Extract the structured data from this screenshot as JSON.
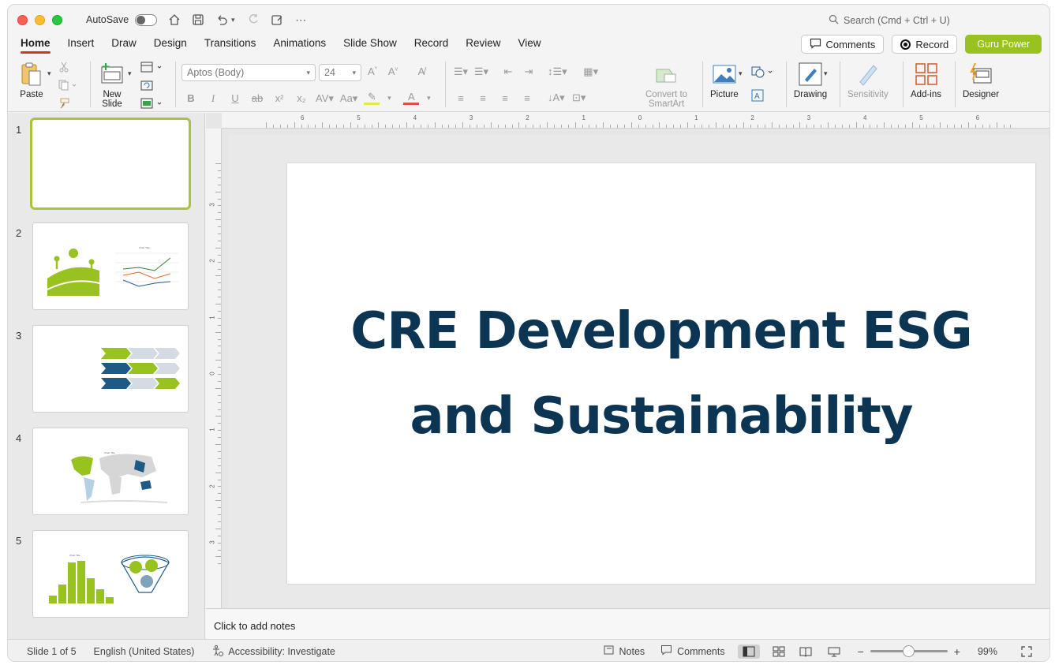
{
  "titlebar": {
    "autosave_label": "AutoSave",
    "search_placeholder": "Search (Cmd + Ctrl + U)"
  },
  "tabs": [
    {
      "label": "Home",
      "active": true
    },
    {
      "label": "Insert"
    },
    {
      "label": "Draw"
    },
    {
      "label": "Design"
    },
    {
      "label": "Transitions"
    },
    {
      "label": "Animations"
    },
    {
      "label": "Slide Show"
    },
    {
      "label": "Record"
    },
    {
      "label": "Review"
    },
    {
      "label": "View"
    }
  ],
  "header_actions": {
    "comments": "Comments",
    "record": "Record",
    "guru": "Guru Power"
  },
  "ribbon": {
    "paste": "Paste",
    "new_slide_1": "New",
    "new_slide_2": "Slide",
    "font_name": "Aptos (Body)",
    "font_size": "24",
    "convert_1": "Convert to",
    "convert_2": "SmartArt",
    "picture": "Picture",
    "drawing": "Drawing",
    "sensitivity": "Sensitivity",
    "addins": "Add-ins",
    "designer": "Designer"
  },
  "ruler": {
    "h_ticks": [
      "6",
      "5",
      "4",
      "3",
      "2",
      "1",
      "0",
      "1",
      "2",
      "3",
      "4",
      "5",
      "6"
    ],
    "v_ticks": [
      "3",
      "2",
      "1",
      "0",
      "1",
      "2",
      "3"
    ]
  },
  "thumbnails": [
    {
      "num": "1"
    },
    {
      "num": "2",
      "chart_title": "Chart Title"
    },
    {
      "num": "3"
    },
    {
      "num": "4",
      "chart_title": "Chart Title"
    },
    {
      "num": "5",
      "chart_title": "Chart Title"
    }
  ],
  "slide": {
    "title_line1": "CRE Development ESG",
    "title_line2": "and Sustainability"
  },
  "notes": {
    "placeholder": "Click to add notes"
  },
  "status": {
    "slide_count": "Slide 1 of 5",
    "language": "English (United States)",
    "accessibility": "Accessibility: Investigate",
    "notes": "Notes",
    "comments": "Comments",
    "zoom": "99%",
    "zoom_fraction": 0.5
  },
  "colors": {
    "accent_green": "#98c21f",
    "title_navy": "#0b3552",
    "tab_underline": "#c43e1c"
  }
}
